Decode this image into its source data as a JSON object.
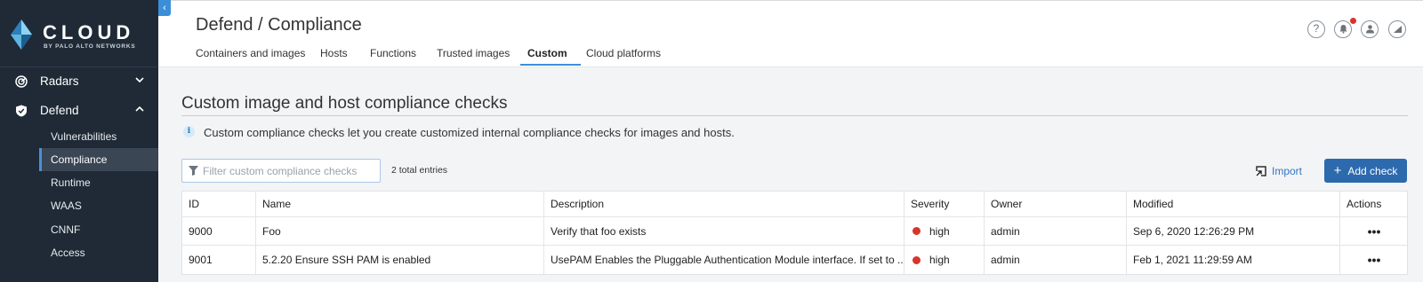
{
  "brand": {
    "name": "CLOUD",
    "sub": "BY PALO ALTO NETWORKS"
  },
  "sidebar": {
    "groups": [
      {
        "label": "Radars",
        "icon": "radar-icon",
        "expanded": false
      },
      {
        "label": "Defend",
        "icon": "shield-icon",
        "expanded": true
      }
    ],
    "defend_items": [
      {
        "label": "Vulnerabilities",
        "active": false
      },
      {
        "label": "Compliance",
        "active": true
      },
      {
        "label": "Runtime",
        "active": false
      },
      {
        "label": "WAAS",
        "active": false
      },
      {
        "label": "CNNF",
        "active": false
      },
      {
        "label": "Access",
        "active": false
      }
    ]
  },
  "header": {
    "title": "Defend / Compliance",
    "tabs": [
      {
        "label": "Containers and images",
        "active": false
      },
      {
        "label": "Hosts",
        "active": false
      },
      {
        "label": "Functions",
        "active": false
      },
      {
        "label": "Trusted images",
        "active": false
      },
      {
        "label": "Custom",
        "active": true
      },
      {
        "label": "Cloud platforms",
        "active": false
      }
    ],
    "icons": [
      "help-icon",
      "notifications-icon",
      "user-icon",
      "signal-icon"
    ]
  },
  "main": {
    "title": "Custom image and host compliance checks",
    "info": "Custom compliance checks let you create customized internal compliance checks for images and hosts.",
    "filter_placeholder": "Filter custom compliance checks",
    "filter_value": "",
    "entries": "2 total entries",
    "import_label": "Import",
    "add_label": "Add check"
  },
  "table": {
    "columns": [
      "ID",
      "Name",
      "Description",
      "Severity",
      "Owner",
      "Modified",
      "Actions"
    ],
    "rows": [
      {
        "id": "9000",
        "name": "Foo",
        "description": "Verify that foo exists",
        "severity": "high",
        "owner": "admin",
        "modified": "Sep 6, 2020 12:26:29 PM",
        "actions": "•••"
      },
      {
        "id": "9001",
        "name": "5.2.20 Ensure SSH PAM is enabled",
        "description": "UsePAM Enables the Pluggable Authentication Module interface. If set to ...",
        "severity": "high",
        "owner": "admin",
        "modified": "Feb 1, 2021 11:29:59 AM",
        "actions": "•••"
      }
    ]
  },
  "colors": {
    "sidebar_bg": "#1f2a36",
    "accent": "#3b8fd9",
    "primary_button": "#2c6aad",
    "severity_high": "#d9342b"
  }
}
